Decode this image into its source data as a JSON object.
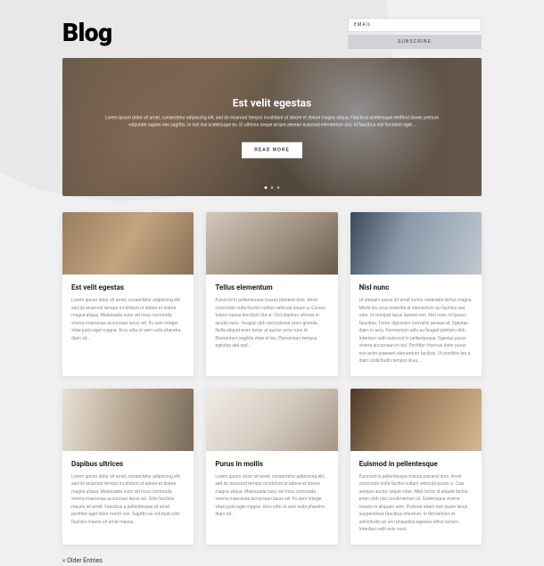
{
  "header": {
    "title": "Blog",
    "email_label": "EMAIL",
    "subscribe_label": "SUBSCRIBE"
  },
  "hero": {
    "title": "Est velit egestas",
    "description": "Lorem ipsum dolor sit amet, consectetur adipiscing elit, sed do eiusmod tempor incididunt ut labore et dolore magna aliqua. Faucibus scelerisque eleifend donec pretium vulputate sapien nec sagittis. In nisl nisi scelerisque eu. Et ultrices neque ornare aenean euismod elementum nisi. Id faucibus nisl tincidunt eget...",
    "button_label": "READ MORE"
  },
  "posts": [
    {
      "title": "Est velit egestas",
      "excerpt": "Lorem ipsum dolor sit amet, consectetur adipiscing elit, sed do eiusmod tempor incididunt ut labore et dolore magna aliqua. Malesuada nunc vel risus commodo viverra maecenas accumsan lacus vel. Eu sem integer vitae justo eget magna. Arcu odio ut sem nulla pharetra diam sit..."
    },
    {
      "title": "Tellus elementum",
      "excerpt": "Euismod in pellentesque massa placerat duis. Amet commodo nulla facilisi nullam vehicula ipsum a. Cursus turpis massa tincidunt dui ut. Orci dapibus ultrices in iaculis nunc. Feugiat nibh sed pulvinar proin gravida. Nulla aliquet enim tortor at auctor urna nunc id. Elementum sagittis vitae et leo. Elementum tempus egestas sed sed..."
    },
    {
      "title": "Nisl nunc",
      "excerpt": "Ut aliquam purus sit amet luctus venenatis lectus magna. Morbi leo urna molestie at elementum eu facilisis sed odio. Id volutpat lacus laoreet non. Nisl nunc mi ipsum faucibus. Tortor dignissim convallis aenean et. Egestas diam in arcu. Fermentum odio eu feugiat pretium nibh. Interdum velit euismod in pellentesque. Egestas purus viverra accumsan in nisl. Porttitor rhoncus dolor purus non enim praesent elementum facilisis. Ut porttitor leo a diam sollicitudin tempor id eu..."
    },
    {
      "title": "Dapibus ultrices",
      "excerpt": "Lorem ipsum dolor sit amet, consectetur adipiscing elit, sed do eiusmod tempor incididunt ut labore et dolore magna aliqua. Malesuada nunc vel risus commodo viverra maecenas accumsan lacus vel. Odio facilisis mauris sit amet. Faucibus a pellentesque sit amet porttitor eget dolor morbi non. Sagittis eu volutpat odio facilisis mauris sit amet massa..."
    },
    {
      "title": "Purus in mollis",
      "excerpt": "Lorem ipsum dolor sit amet, consectetur adipiscing elit, sed do eiusmod tempor incididunt ut labore et dolore magna aliqua. Malesuada nunc vel risus commodo viverra maecenas accumsan lacus vel. Eu sem integer vitae justo eget magna. Arcu odio ut sem nulla pharetra diam sit..."
    },
    {
      "title": "Euismod in pellentesque",
      "excerpt": "Euismod in pellentesque massa placerat duis. Amet commodo nulla facilisi nullam vehicula ipsum a. Cras semper auctor neque vitae. Nibh tortor id aliquet lectus proin nibh nisl condimentum id. Scelerisque viverra mauris in aliquam sem. Pulvinar etiam non quam lacus suspendisse faucibus interdum. In fermentum et sollicitudin ac orci phasellus egestas tellus rutrum. Interdum velit euis mod..."
    }
  ],
  "pagination": {
    "older": "« Older Entries"
  }
}
